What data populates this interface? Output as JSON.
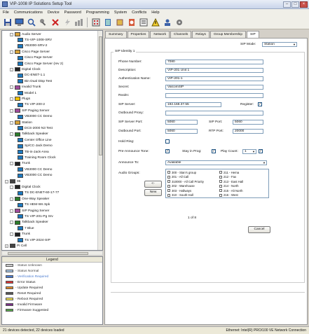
{
  "window": {
    "title": "VIP-1008 IP Solutions Setup Tool",
    "minimize": "–",
    "maximize": "□",
    "close": "×"
  },
  "menu": [
    "File",
    "Communications",
    "Device",
    "Password",
    "Programming",
    "System",
    "Conflicts",
    "Help"
  ],
  "toolbar_icons": [
    "save-icon",
    "computer-icon",
    "search-icon",
    "key-icon",
    "delete-icon",
    "lightning-icon",
    "network-icon",
    "keypad-icon",
    "book-icon",
    "device-icon",
    "speaker-icon",
    "panel-icon",
    "warning-icon",
    "user-icon",
    "settings-icon"
  ],
  "tree": [
    {
      "label": "Audio Server",
      "level": 2,
      "exp": "-",
      "color": "#d9a43a"
    },
    {
      "label": "TS-VIP-1008-SRV",
      "level": 3,
      "color": "#1c79c0"
    },
    {
      "label": "VB3000-SRV-2",
      "level": 3,
      "color": "#1c79c0"
    },
    {
      "label": "Cisco Page Server",
      "level": 2,
      "exp": "-",
      "color": "#d9a43a"
    },
    {
      "label": "Cisco Page Server",
      "level": 3,
      "color": "#1c79c0"
    },
    {
      "label": "Cisco Page Server (rev 2)",
      "level": 3,
      "color": "#1c79c0"
    },
    {
      "label": "Digital Clock",
      "level": 2,
      "exp": "-",
      "color": "#222"
    },
    {
      "label": "DC-ENET-1.1",
      "level": 3,
      "color": "#1c79c0"
    },
    {
      "label": "Bin Dual Disp Test",
      "level": 3,
      "color": "#1c79c0"
    },
    {
      "label": "Invalid Trunk",
      "level": 2,
      "exp": "-",
      "color": "#a04c9c"
    },
    {
      "label": "Model 1",
      "level": 3,
      "color": "#1c79c0"
    },
    {
      "label": "Plugs",
      "level": 2,
      "exp": "-",
      "color": "#f3c300"
    },
    {
      "label": "TS VIP-200-2",
      "level": 3,
      "color": "#1c79c0"
    },
    {
      "label": "SIP Paging Server",
      "level": 2,
      "exp": "-",
      "color": "#a04c9c"
    },
    {
      "label": "VB3000 CC Demo",
      "level": 3,
      "color": "#1c79c0"
    },
    {
      "label": "Station",
      "level": 2,
      "exp": "-",
      "color": "#d9a43a"
    },
    {
      "label": "DCS-2000 N3 Test",
      "level": 3,
      "color": "#1c79c0"
    },
    {
      "label": "Talkback Speaker",
      "level": 2,
      "exp": "-",
      "color": "#2d7c2a"
    },
    {
      "label": "Center Office Line",
      "level": 3,
      "color": "#1c79c0"
    },
    {
      "label": "Sp/CC-Jack Demo",
      "level": 3,
      "color": "#1c79c0"
    },
    {
      "label": "TB-in-Jack-Area",
      "level": 3,
      "color": "#1c79c0"
    },
    {
      "label": "Training Room Clock",
      "level": 3,
      "color": "#1c79c0"
    },
    {
      "label": "Trunk",
      "level": 2,
      "exp": "-",
      "color": "#222"
    },
    {
      "label": "VB3000 CC Demo",
      "level": 3,
      "color": "#1c79c0"
    },
    {
      "label": "VB3000 CC Demo",
      "level": 3,
      "color": "#1c79c0"
    },
    {
      "label": "96",
      "level": 1,
      "exp": "-",
      "color": "#444"
    },
    {
      "label": "Digital Clock",
      "level": 2,
      "exp": "-",
      "color": "#222"
    },
    {
      "label": "TS DC-ENET-60-17-77",
      "level": 3,
      "color": "#1c79c0"
    },
    {
      "label": "One-Way Speaker",
      "level": 2,
      "exp": "-",
      "color": "#2d7c2a"
    },
    {
      "label": "TS HEM-Ws Spk",
      "level": 3,
      "color": "#1c79c0"
    },
    {
      "label": "SIP Paging Server",
      "level": 2,
      "exp": "-",
      "color": "#a04c9c"
    },
    {
      "label": "TS VIP-201-Pg Srv",
      "level": 3,
      "color": "#1c79c0"
    },
    {
      "label": "Talkback Speaker",
      "level": 2,
      "exp": "-",
      "color": "#2d7c2a"
    },
    {
      "label": "7 Blue",
      "level": 3,
      "color": "#1c79c0"
    },
    {
      "label": "Trunk",
      "level": 2,
      "exp": "-",
      "color": "#222"
    },
    {
      "label": "TS VIP-2024-SIP",
      "level": 3,
      "color": "#1c79c0"
    },
    {
      "label": "PI Cell",
      "level": 1,
      "exp": "+",
      "color": "#444"
    }
  ],
  "legend": {
    "title": "Legend",
    "items": [
      {
        "label": "- Status Unknown",
        "color": "#cfcfcf",
        "text_color": "#444"
      },
      {
        "label": "- Status Normal",
        "color": "#a9c9e8",
        "text_color": "#444"
      },
      {
        "label": "- Verification Required",
        "color": "#4a7bd0",
        "text_color": "#4a7bd0"
      },
      {
        "label": "- Error Status",
        "color": "#d33",
        "text_color": "#222"
      },
      {
        "label": "- Update Required",
        "color": "#e08a2a",
        "text_color": "#222"
      },
      {
        "label": "- Reset Required",
        "color": "#555",
        "text_color": "#222"
      },
      {
        "label": "- Reboot Required",
        "color": "#f4e34f",
        "text_color": "#222"
      },
      {
        "label": "- Invalid Firmware",
        "color": "#7b2f8a",
        "text_color": "#222"
      },
      {
        "label": "- Firmware Suggested",
        "color": "#56a24a",
        "text_color": "#222"
      }
    ]
  },
  "tabs": [
    "Summary",
    "Properties",
    "Network",
    "Channels",
    "Relays",
    "Group Membership",
    "SIP"
  ],
  "sip": {
    "mode_label": "SIP Mode:",
    "mode_value": "Station",
    "group_title": "SIP Identity 1",
    "fields": {
      "phone_number": {
        "label": "Phone Number:",
        "value": "7080"
      },
      "description": {
        "label": "Description:",
        "value": "VIP-201 Unit 1"
      },
      "auth_name": {
        "label": "Authentication Name:",
        "value": "VIP-201-1"
      },
      "secret": {
        "label": "Secret:",
        "value": "ValcomSIP"
      },
      "realm": {
        "label": "Realm:",
        "value": ""
      },
      "sip_server": {
        "label": "SIP Server:",
        "value": "192.168.37.55"
      },
      "register_label": "Register:",
      "outbound_proxy": {
        "label": "Outbound Proxy:",
        "value": ""
      },
      "sip_server_port": {
        "label": "SIP Server Port:",
        "value": "5060"
      },
      "sip_port": {
        "label": "SIP Port:",
        "value": "5060"
      },
      "outbound_port": {
        "label": "Outbound Port:",
        "value": "5060"
      },
      "rtp_port": {
        "label": "RTP Port:",
        "value": "20000"
      },
      "hold_ring": {
        "label": "Hold Ring:"
      },
      "pre_announce": {
        "label": "Pre-Announce Tone:"
      },
      "stay_in_prog": {
        "label": "Stay in Prog:"
      },
      "play_count": {
        "label": "Play Count:",
        "value": "1"
      },
      "announce_to": {
        "label": "Announce To:",
        "value": "Available"
      },
      "audio_groups": {
        "label": "Audio Groups:"
      }
    },
    "audio_groups_left": [
      "300 - Stan's group",
      "201 - All Call",
      "310000 - All Call Priority",
      "202 - Warehouse",
      "303 - Hallways",
      "310 - South Hall"
    ],
    "audio_groups_right": [
      "211 - Hema",
      "212 - Fax",
      "213 - East Hall",
      "214 - North",
      "215 - Alt North",
      "216 - West"
    ],
    "buttons": {
      "add": "<-",
      "new": "New",
      "cancel": "Cancel"
    },
    "pager": "1 of 8"
  },
  "status": {
    "left": "21 devices detected, 22 devices loaded",
    "right": "Ethernet: Intel(R) PRO/100 VE Network Connection"
  }
}
